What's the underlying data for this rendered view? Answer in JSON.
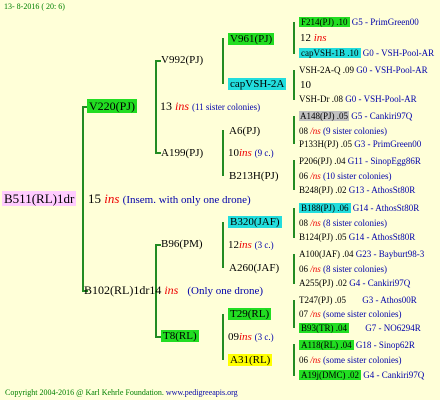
{
  "header": {
    "date": "13-  8-2016 (  20:  6)"
  },
  "root": {
    "name": "B511(RL)1dr",
    "num": "15",
    "ins": "ins",
    "note": "(Insem. with only one drone)"
  },
  "upper": {
    "name": "V220(PJ)",
    "num": "13",
    "ins": "ins",
    "note": "(11 sister colonies)",
    "a": {
      "name": "V992(PJ)",
      "a": {
        "name": "V961(PJ)",
        "num": "12",
        "ins": "ins",
        "a": {
          "name": "F214(PJ) .10",
          "tail": "G5 - PrimGreen00"
        },
        "b": {
          "name": "capVSH-1B .10",
          "tail": "G0 - VSH-Pool-AR"
        }
      },
      "b": {
        "name": "capVSH-2A",
        "num": "10",
        "a": {
          "name": "VSH-2A-Q .09",
          "tail": "G0 - VSH-Pool-AR"
        },
        "b": {
          "name": "VSH-Dr .08",
          "tail": "G0 - VSH-Pool-AR"
        }
      }
    },
    "b": {
      "name": "A199(PJ)",
      "num": "10",
      "ins": "ins",
      "note": "(9 c.)",
      "a": {
        "name": "A6(PJ)",
        "num": "08",
        "ins": "/ns",
        "note": "(9 sister colonies)",
        "a": {
          "name": "A148(PJ) .05",
          "tail": "G5 - Cankiri97Q"
        },
        "b": {
          "name": "P133H(PJ) .05",
          "tail": "G3 - PrimGreen00"
        }
      },
      "b": {
        "name": "B213H(PJ)",
        "num": "06",
        "ins": "/ns",
        "note": "(10 sister colonies)",
        "a": {
          "name": "P206(PJ) .04",
          "tail": "G11 - SinopEgg86R"
        },
        "b": {
          "name": "B248(PJ) .02",
          "tail": "G13 - AthosSt80R"
        }
      }
    }
  },
  "lower": {
    "name": "B102(RL)1dr",
    "num": "14",
    "ins": "ins",
    "note": "(Only one drone)",
    "a": {
      "name": "B96(PM)",
      "a": {
        "name": "B320(JAF)",
        "num": "12",
        "ins": "ins",
        "note": "(3 c.)",
        "a": {
          "name": "B188(PJ) .06",
          "tail": "G14 - AthosSt80R"
        },
        "b": {
          "name": "B124(PJ) .05",
          "tail": "G14 - AthosSt80R"
        },
        "num2": "08",
        "ins2": "/ns",
        "note2": "(8 sister colonies)"
      },
      "b": {
        "name": "A260(JAF)",
        "num": "06",
        "ins": "/ns",
        "note": "(8 sister colonies)",
        "a": {
          "name": "A100(JAF) .04",
          "tail": "G23 - Bayburt98-3"
        },
        "b": {
          "name": "A255(PJ) .02",
          "tail": "G4 - Cankiri97Q"
        }
      }
    },
    "b": {
      "name": "T8(RL)",
      "num": "09",
      "ins": "ins",
      "note": "(3 c.)",
      "a": {
        "name": "T29(RL)",
        "num": "07",
        "ins": "/ns",
        "note": "(some sister colonies)",
        "a": {
          "name": "T247(PJ) .05",
          "tail": "G3 - Athos00R"
        },
        "b": {
          "name": "B93(TR) .04",
          "tail": "G7 - NO6294R"
        }
      },
      "b": {
        "name": "A31(RL)",
        "num": "06",
        "ins": "/ns",
        "note": "(some sister colonies)",
        "a": {
          "name": "A118(RL) .04",
          "tail": "G18 - Sinop62R"
        },
        "b": {
          "name": "A19j(DMC) .02",
          "tail": "G4 - Cankiri97Q"
        }
      }
    }
  },
  "footer": {
    "copyright": "Copyright 2004-2016 @ Karl Kehrle Foundation.",
    "site": "www.pedigreeapis.org"
  }
}
